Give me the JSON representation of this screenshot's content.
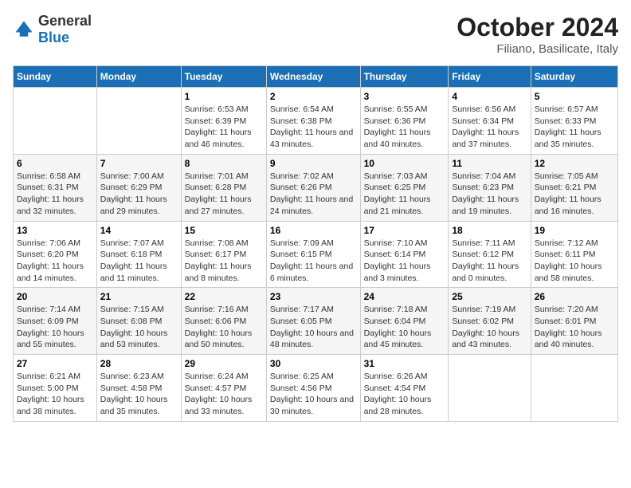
{
  "header": {
    "logo": {
      "general": "General",
      "blue": "Blue"
    },
    "title": "October 2024",
    "location": "Filiano, Basilicate, Italy"
  },
  "weekdays": [
    "Sunday",
    "Monday",
    "Tuesday",
    "Wednesday",
    "Thursday",
    "Friday",
    "Saturday"
  ],
  "weeks": [
    [
      {
        "day": "",
        "sunrise": "",
        "sunset": "",
        "daylight": ""
      },
      {
        "day": "",
        "sunrise": "",
        "sunset": "",
        "daylight": ""
      },
      {
        "day": "1",
        "sunrise": "Sunrise: 6:53 AM",
        "sunset": "Sunset: 6:39 PM",
        "daylight": "Daylight: 11 hours and 46 minutes."
      },
      {
        "day": "2",
        "sunrise": "Sunrise: 6:54 AM",
        "sunset": "Sunset: 6:38 PM",
        "daylight": "Daylight: 11 hours and 43 minutes."
      },
      {
        "day": "3",
        "sunrise": "Sunrise: 6:55 AM",
        "sunset": "Sunset: 6:36 PM",
        "daylight": "Daylight: 11 hours and 40 minutes."
      },
      {
        "day": "4",
        "sunrise": "Sunrise: 6:56 AM",
        "sunset": "Sunset: 6:34 PM",
        "daylight": "Daylight: 11 hours and 37 minutes."
      },
      {
        "day": "5",
        "sunrise": "Sunrise: 6:57 AM",
        "sunset": "Sunset: 6:33 PM",
        "daylight": "Daylight: 11 hours and 35 minutes."
      }
    ],
    [
      {
        "day": "6",
        "sunrise": "Sunrise: 6:58 AM",
        "sunset": "Sunset: 6:31 PM",
        "daylight": "Daylight: 11 hours and 32 minutes."
      },
      {
        "day": "7",
        "sunrise": "Sunrise: 7:00 AM",
        "sunset": "Sunset: 6:29 PM",
        "daylight": "Daylight: 11 hours and 29 minutes."
      },
      {
        "day": "8",
        "sunrise": "Sunrise: 7:01 AM",
        "sunset": "Sunset: 6:28 PM",
        "daylight": "Daylight: 11 hours and 27 minutes."
      },
      {
        "day": "9",
        "sunrise": "Sunrise: 7:02 AM",
        "sunset": "Sunset: 6:26 PM",
        "daylight": "Daylight: 11 hours and 24 minutes."
      },
      {
        "day": "10",
        "sunrise": "Sunrise: 7:03 AM",
        "sunset": "Sunset: 6:25 PM",
        "daylight": "Daylight: 11 hours and 21 minutes."
      },
      {
        "day": "11",
        "sunrise": "Sunrise: 7:04 AM",
        "sunset": "Sunset: 6:23 PM",
        "daylight": "Daylight: 11 hours and 19 minutes."
      },
      {
        "day": "12",
        "sunrise": "Sunrise: 7:05 AM",
        "sunset": "Sunset: 6:21 PM",
        "daylight": "Daylight: 11 hours and 16 minutes."
      }
    ],
    [
      {
        "day": "13",
        "sunrise": "Sunrise: 7:06 AM",
        "sunset": "Sunset: 6:20 PM",
        "daylight": "Daylight: 11 hours and 14 minutes."
      },
      {
        "day": "14",
        "sunrise": "Sunrise: 7:07 AM",
        "sunset": "Sunset: 6:18 PM",
        "daylight": "Daylight: 11 hours and 11 minutes."
      },
      {
        "day": "15",
        "sunrise": "Sunrise: 7:08 AM",
        "sunset": "Sunset: 6:17 PM",
        "daylight": "Daylight: 11 hours and 8 minutes."
      },
      {
        "day": "16",
        "sunrise": "Sunrise: 7:09 AM",
        "sunset": "Sunset: 6:15 PM",
        "daylight": "Daylight: 11 hours and 6 minutes."
      },
      {
        "day": "17",
        "sunrise": "Sunrise: 7:10 AM",
        "sunset": "Sunset: 6:14 PM",
        "daylight": "Daylight: 11 hours and 3 minutes."
      },
      {
        "day": "18",
        "sunrise": "Sunrise: 7:11 AM",
        "sunset": "Sunset: 6:12 PM",
        "daylight": "Daylight: 11 hours and 0 minutes."
      },
      {
        "day": "19",
        "sunrise": "Sunrise: 7:12 AM",
        "sunset": "Sunset: 6:11 PM",
        "daylight": "Daylight: 10 hours and 58 minutes."
      }
    ],
    [
      {
        "day": "20",
        "sunrise": "Sunrise: 7:14 AM",
        "sunset": "Sunset: 6:09 PM",
        "daylight": "Daylight: 10 hours and 55 minutes."
      },
      {
        "day": "21",
        "sunrise": "Sunrise: 7:15 AM",
        "sunset": "Sunset: 6:08 PM",
        "daylight": "Daylight: 10 hours and 53 minutes."
      },
      {
        "day": "22",
        "sunrise": "Sunrise: 7:16 AM",
        "sunset": "Sunset: 6:06 PM",
        "daylight": "Daylight: 10 hours and 50 minutes."
      },
      {
        "day": "23",
        "sunrise": "Sunrise: 7:17 AM",
        "sunset": "Sunset: 6:05 PM",
        "daylight": "Daylight: 10 hours and 48 minutes."
      },
      {
        "day": "24",
        "sunrise": "Sunrise: 7:18 AM",
        "sunset": "Sunset: 6:04 PM",
        "daylight": "Daylight: 10 hours and 45 minutes."
      },
      {
        "day": "25",
        "sunrise": "Sunrise: 7:19 AM",
        "sunset": "Sunset: 6:02 PM",
        "daylight": "Daylight: 10 hours and 43 minutes."
      },
      {
        "day": "26",
        "sunrise": "Sunrise: 7:20 AM",
        "sunset": "Sunset: 6:01 PM",
        "daylight": "Daylight: 10 hours and 40 minutes."
      }
    ],
    [
      {
        "day": "27",
        "sunrise": "Sunrise: 6:21 AM",
        "sunset": "Sunset: 5:00 PM",
        "daylight": "Daylight: 10 hours and 38 minutes."
      },
      {
        "day": "28",
        "sunrise": "Sunrise: 6:23 AM",
        "sunset": "Sunset: 4:58 PM",
        "daylight": "Daylight: 10 hours and 35 minutes."
      },
      {
        "day": "29",
        "sunrise": "Sunrise: 6:24 AM",
        "sunset": "Sunset: 4:57 PM",
        "daylight": "Daylight: 10 hours and 33 minutes."
      },
      {
        "day": "30",
        "sunrise": "Sunrise: 6:25 AM",
        "sunset": "Sunset: 4:56 PM",
        "daylight": "Daylight: 10 hours and 30 minutes."
      },
      {
        "day": "31",
        "sunrise": "Sunrise: 6:26 AM",
        "sunset": "Sunset: 4:54 PM",
        "daylight": "Daylight: 10 hours and 28 minutes."
      },
      {
        "day": "",
        "sunrise": "",
        "sunset": "",
        "daylight": ""
      },
      {
        "day": "",
        "sunrise": "",
        "sunset": "",
        "daylight": ""
      }
    ]
  ]
}
